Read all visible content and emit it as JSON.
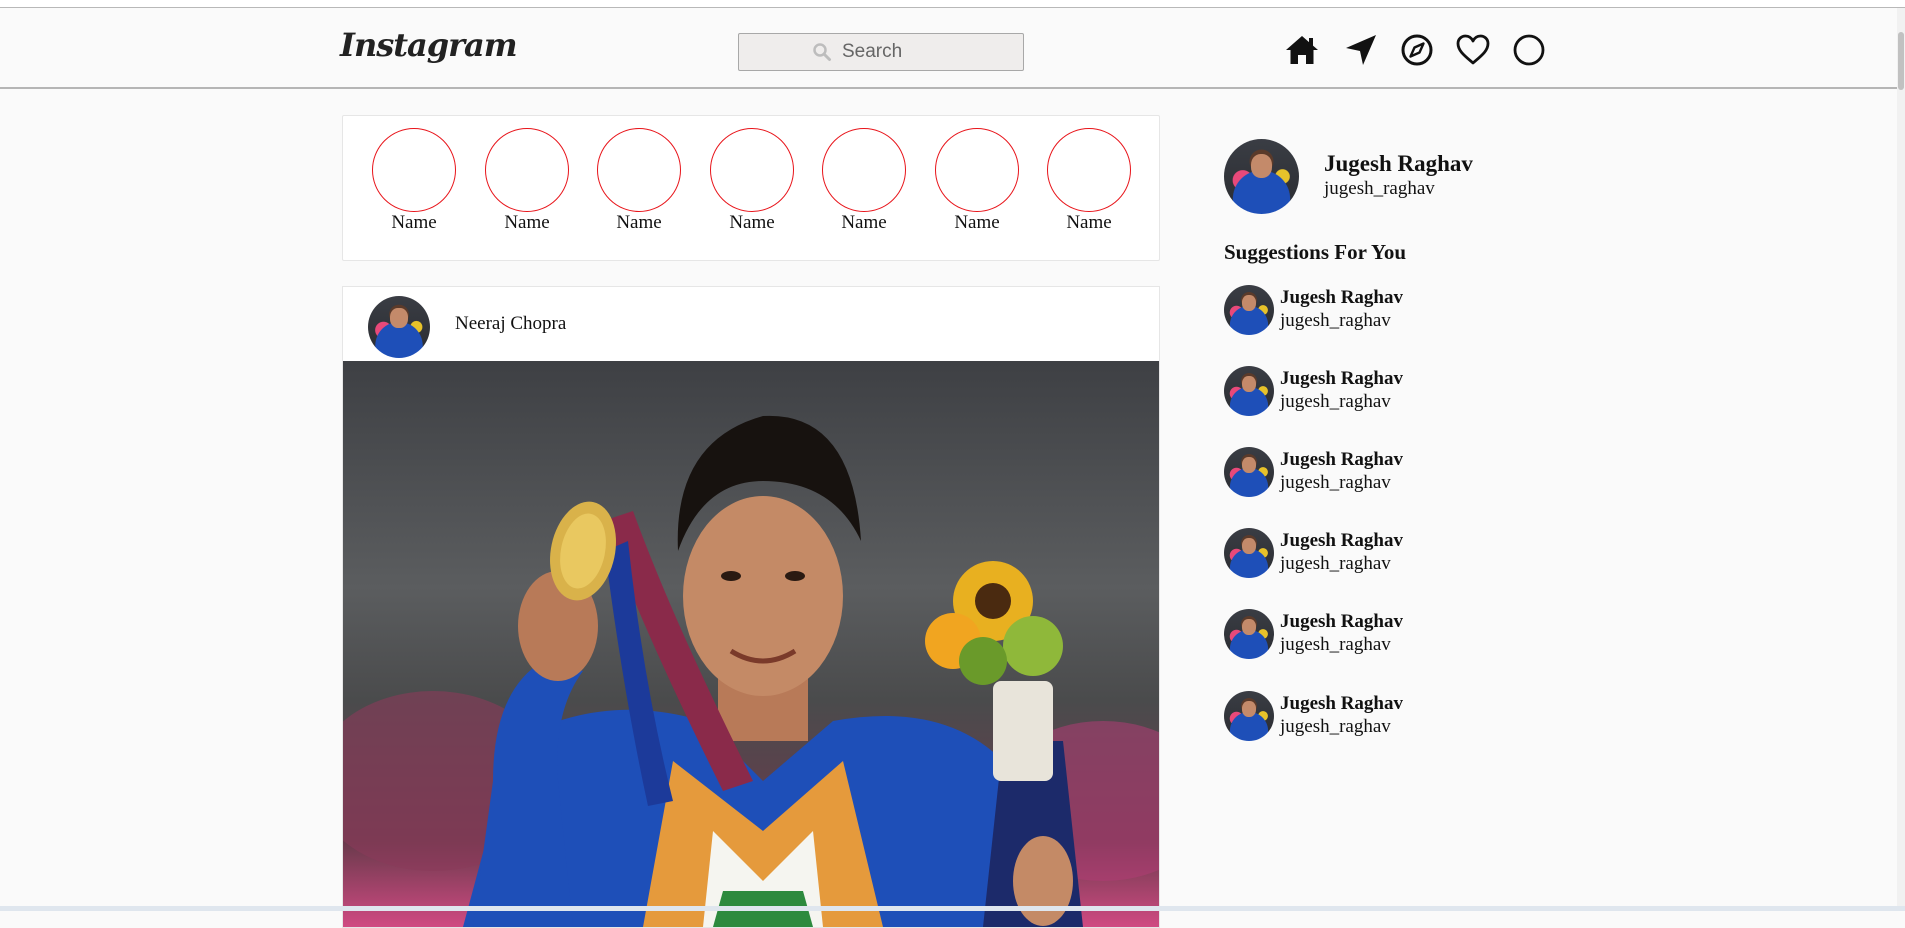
{
  "navbar": {
    "logo": "Instagram",
    "search_placeholder": "Search",
    "icons": [
      "home-icon",
      "direct-send-icon",
      "explore-compass-icon",
      "heart-icon",
      "profile-circle-icon"
    ]
  },
  "stories": [
    {
      "name": "Name"
    },
    {
      "name": "Name"
    },
    {
      "name": "Name"
    },
    {
      "name": "Name"
    },
    {
      "name": "Name"
    },
    {
      "name": "Name"
    },
    {
      "name": "Name"
    }
  ],
  "post": {
    "author": "Neeraj Chopra"
  },
  "profile": {
    "name": "Jugesh Raghav",
    "handle": "jugesh_raghav"
  },
  "suggestions": {
    "title": "Suggestions For You",
    "items": [
      {
        "name": "Jugesh Raghav",
        "handle": "jugesh_raghav"
      },
      {
        "name": "Jugesh Raghav",
        "handle": "jugesh_raghav"
      },
      {
        "name": "Jugesh Raghav",
        "handle": "jugesh_raghav"
      },
      {
        "name": "Jugesh Raghav",
        "handle": "jugesh_raghav"
      },
      {
        "name": "Jugesh Raghav",
        "handle": "jugesh_raghav"
      },
      {
        "name": "Jugesh Raghav",
        "handle": "jugesh_raghav"
      }
    ]
  },
  "colors": {
    "story_ring": "#e8141a",
    "background": "#fafafa"
  }
}
